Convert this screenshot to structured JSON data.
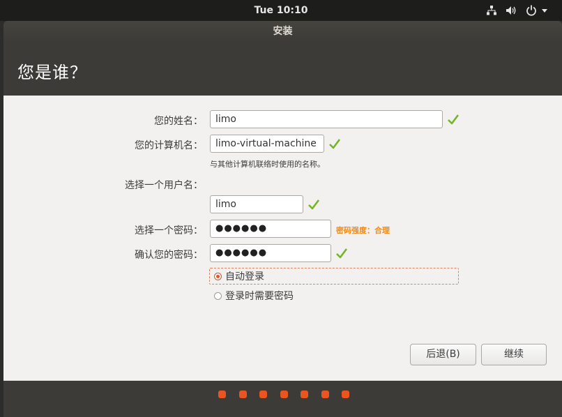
{
  "topbar": {
    "clock": "Tue 10:10"
  },
  "window": {
    "title": "安装"
  },
  "page": {
    "title": "您是谁？"
  },
  "form": {
    "name_label": "您的姓名：",
    "name_value": "limo",
    "computer_label": "您的计算机名：",
    "computer_value": "limo-virtual-machine",
    "computer_hint": "与其他计算机联络时使用的名称。",
    "username_label": "选择一个用户名：",
    "username_value": "limo",
    "password_label": "选择一个密码：",
    "password_value": "●●●●●●",
    "password_strength": "密码强度：合理",
    "confirm_label": "确认您的密码：",
    "confirm_value": "●●●●●●",
    "autologin_label": "自动登录",
    "require_password_label": "登录时需要密码",
    "selected_login_option": "autologin"
  },
  "buttons": {
    "back": "后退(B)",
    "continue": "继续"
  },
  "progress": {
    "steps": 7
  },
  "colors": {
    "accent": "#e95420",
    "check": "#73b528",
    "strength": "#f08b19",
    "window_bg": "#3c3b37"
  },
  "icons": [
    "network-icon",
    "volume-icon",
    "power-icon",
    "chevron-down-icon",
    "close-icon",
    "checkmark-icon"
  ]
}
